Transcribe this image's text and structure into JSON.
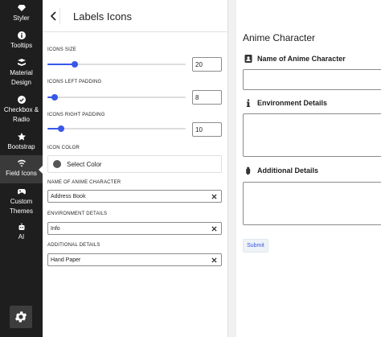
{
  "sidebar": {
    "items": [
      {
        "icon": "diamond-icon",
        "label": "Styler"
      },
      {
        "icon": "info-icon",
        "label": "Tooltips"
      },
      {
        "icon": "material-icon",
        "label": "Material Design"
      },
      {
        "icon": "check-circle-icon",
        "label": "Checkbox & Radio"
      },
      {
        "icon": "star-icon",
        "label": "Bootstrap"
      },
      {
        "icon": "field-icons-icon",
        "label": "Field Icons"
      },
      {
        "icon": "gamepad-icon",
        "label": "Custom Themes"
      },
      {
        "icon": "robot-icon",
        "label": "AI"
      }
    ],
    "active": "Field Icons",
    "settings_icon": "gear-icon"
  },
  "panel": {
    "title": "Labels Icons",
    "icons_size": {
      "label": "Icons Size",
      "value": "20",
      "fraction": 0.2
    },
    "icons_left_padding": {
      "label": "Icons Left Padding",
      "value": "8",
      "fraction": 0.05
    },
    "icons_right_padding": {
      "label": "Icons Right Padding",
      "value": "10",
      "fraction": 0.1
    },
    "icon_color": {
      "label": "Icon Color",
      "button": "Select Color",
      "swatch": "#555555"
    },
    "fields": [
      {
        "label": "Name of Anime Character",
        "value": "Address Book"
      },
      {
        "label": "Environment Details",
        "value": "Info"
      },
      {
        "label": "Additional Details",
        "value": "Hand Paper"
      }
    ]
  },
  "preview": {
    "title": "Anime Character",
    "fields": [
      {
        "label": "Name of Anime Character",
        "icon": "address-book-icon"
      },
      {
        "label": "Environment Details",
        "icon": "info-icon"
      },
      {
        "label": "Additional Details",
        "icon": "hand-paper-icon"
      }
    ],
    "submit": "Submit"
  },
  "colors": {
    "accent": "#3858e9",
    "sidebar": "#1e1e1e"
  }
}
